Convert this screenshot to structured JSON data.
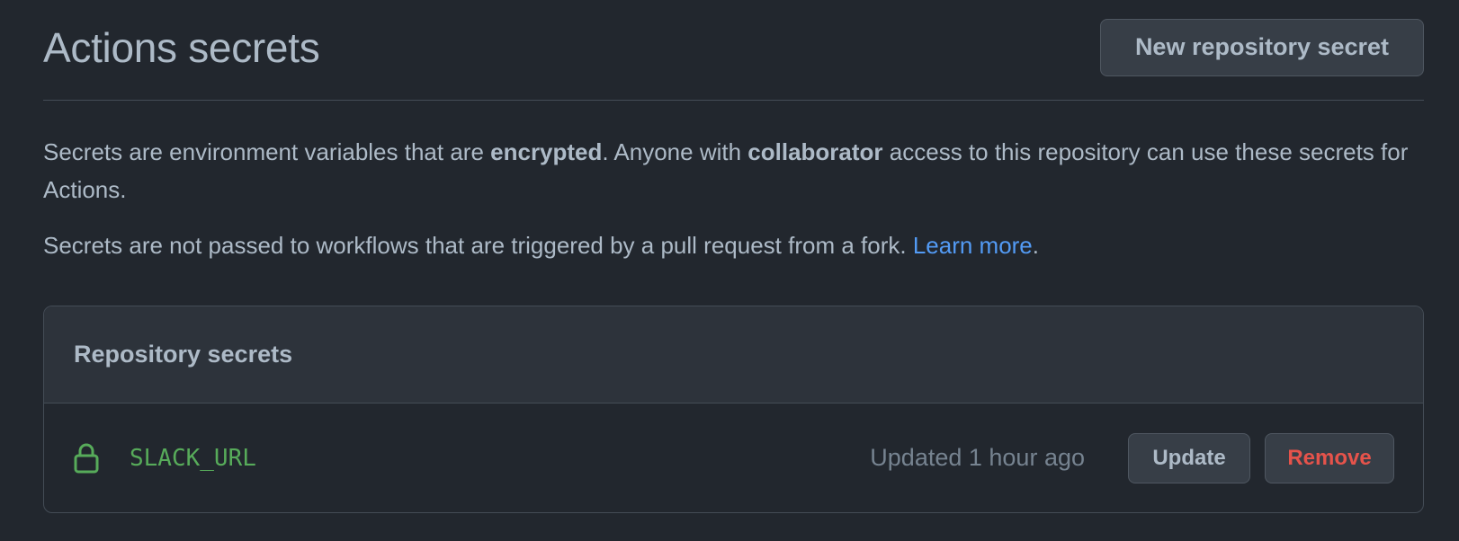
{
  "header": {
    "title": "Actions secrets",
    "new_secret_button": "New repository secret"
  },
  "description": {
    "p1_part1": "Secrets are environment variables that are ",
    "p1_bold1": "encrypted",
    "p1_part2": ". Anyone with ",
    "p1_bold2": "collaborator",
    "p1_part3": " access to this repository can use these secrets for Actions.",
    "p2_text": "Secrets are not passed to workflows that are triggered by a pull request from a fork. ",
    "p2_link": "Learn more",
    "p2_end": "."
  },
  "secrets_box": {
    "title": "Repository secrets",
    "items": [
      {
        "icon": "lock-icon",
        "name": "SLACK_URL",
        "updated": "Updated 1 hour ago",
        "update_label": "Update",
        "remove_label": "Remove"
      }
    ]
  },
  "colors": {
    "background": "#22272e",
    "text": "#adbac7",
    "link": "#539bf5",
    "secret_name": "#57ab5a",
    "danger": "#e5534b",
    "muted": "#768390"
  }
}
